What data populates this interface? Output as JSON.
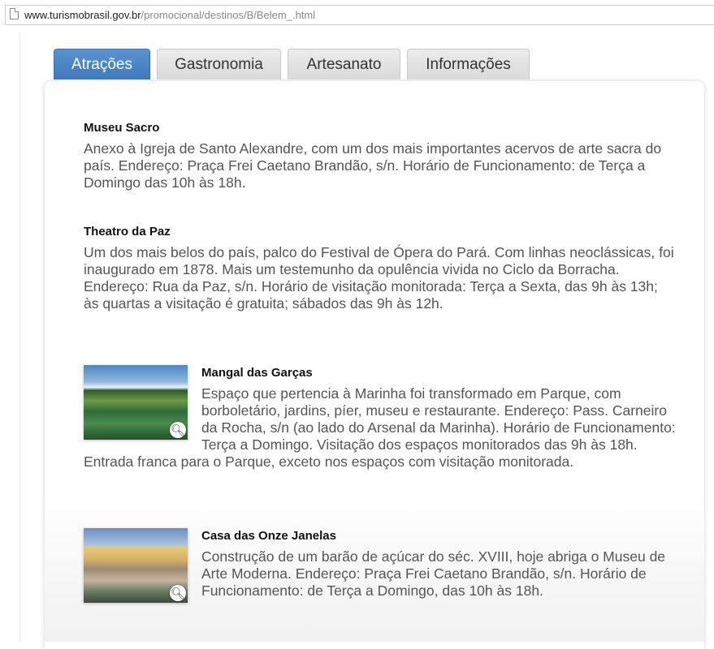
{
  "address_bar": {
    "url_domain": "www.turismobrasil.gov.br",
    "url_path": "/promocional/destinos/B/Belem_.html"
  },
  "tabs": [
    {
      "label": "Atrações",
      "active": true
    },
    {
      "label": "Gastronomia",
      "active": false
    },
    {
      "label": "Artesanato",
      "active": false
    },
    {
      "label": "Informações",
      "active": false
    }
  ],
  "attractions": [
    {
      "title": "Museu Sacro",
      "description": "Anexo à Igreja de Santo Alexandre, com um dos mais importantes acervos de arte sacra do país. Endereço: Praça Frei Caetano Brandão, s/n. Horário de Funcionamento: de Terça a Domingo das 10h às 18h."
    },
    {
      "title": "Theatro da Paz",
      "description": "Um dos mais belos do país, palco do Festival de Ópera do Pará. Com linhas neoclássicas, foi inaugurado em 1878. Mais um testemunho da opulência vivida no Ciclo da Borracha. Endereço: Rua da Paz, s/n. Horário de visitação monitorada: Terça a Sexta, das 9h às 13h; às quartas a visitação é gratuita; sábados das 9h às 12h."
    },
    {
      "title": "Mangal das Garças",
      "description": "Espaço que pertencia à Marinha foi transformado em Parque, com borboletário, jardins, píer, museu e restaurante. Endereço: Pass. Carneiro da Rocha, s/n (ao lado do Arsenal da Marinha). Horário de Funcionamento: Terça a Domingo. Visitação dos espaços monitorados das 9h às 18h. Entrada franca para o Parque, exceto nos espaços com visitação monitorada."
    },
    {
      "title": "Casa das Onze Janelas",
      "description": "Construção de um barão de açúcar do séc. XVIII, hoje abriga o Museu de Arte Moderna. Endereço: Praça Frei Caetano Brandão, s/n. Horário de Funcionamento: de Terça a Domingo, das 10h às 18h."
    }
  ],
  "icons": {
    "page": "page-icon",
    "zoom": "magnifier-icon"
  }
}
